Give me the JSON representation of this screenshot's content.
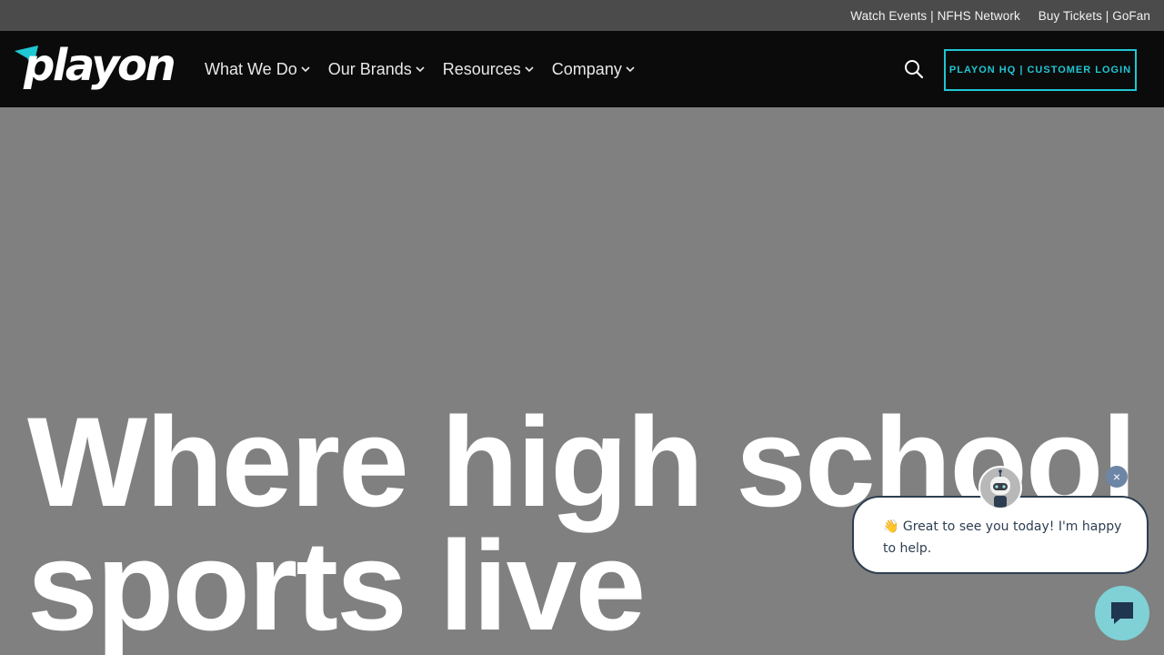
{
  "topbar": {
    "links": [
      {
        "label": "Watch Events | NFHS Network"
      },
      {
        "label": "Buy Tickets | GoFan"
      }
    ]
  },
  "nav": {
    "logo_text": "playon",
    "menu": [
      {
        "label": "What We Do"
      },
      {
        "label": "Our Brands"
      },
      {
        "label": "Resources"
      },
      {
        "label": "Company"
      }
    ],
    "login_label": "PLAYON HQ | CUSTOMER LOGIN"
  },
  "hero": {
    "headline": "Where high school sports live"
  },
  "chat": {
    "message": "👋 Great to see you today! I'm happy to help.",
    "close_label": "×"
  },
  "colors": {
    "accent": "#1fc6d3",
    "nav_bg": "#0b0b0b",
    "topbar_bg": "#4b4b4b",
    "hero_bg": "#808080"
  },
  "icons": [
    "search-icon",
    "chevron-down-icon",
    "close-icon",
    "chat-icon",
    "bot-avatar"
  ]
}
